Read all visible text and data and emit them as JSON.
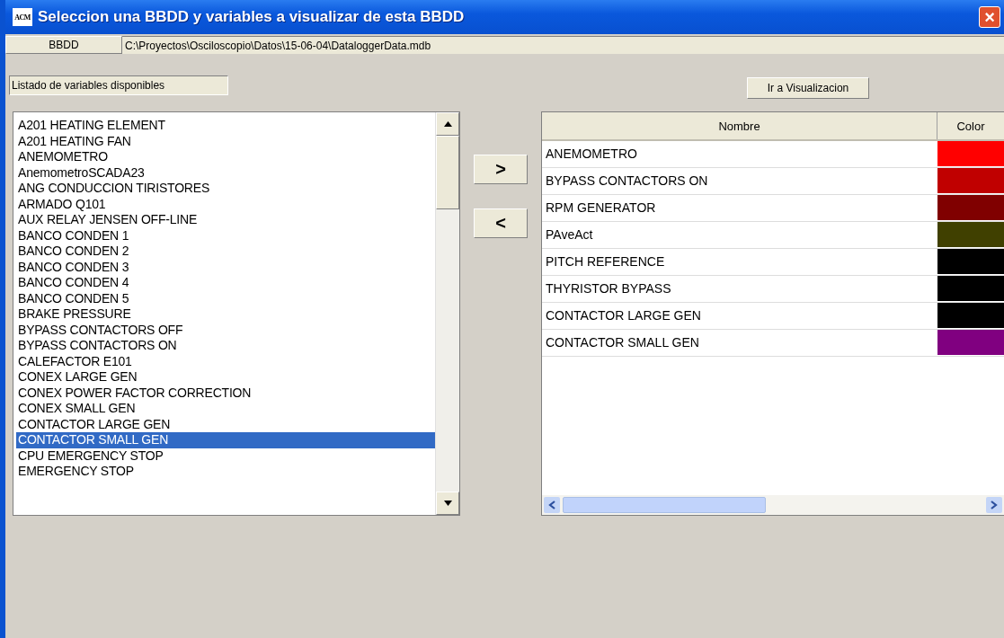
{
  "window": {
    "title": "Seleccion una BBDD y variables a visualizar de esta BBDD",
    "icon_letters": "ACM",
    "close": "×"
  },
  "database": {
    "button": "BBDD",
    "path": "C:\\Proyectos\\Osciloscopio\\Datos\\15-06-04\\DataloggerData.mdb"
  },
  "available_label": "Listado de variables disponibles",
  "go_button": "Ir a Visualizacion",
  "available": [
    {
      "label": "A201 HEATING ELEMENT",
      "selected": false
    },
    {
      "label": "A201 HEATING FAN",
      "selected": false
    },
    {
      "label": "ANEMOMETRO",
      "selected": false
    },
    {
      "label": "AnemometroSCADA23",
      "selected": false
    },
    {
      "label": "ANG CONDUCCION TIRISTORES",
      "selected": false
    },
    {
      "label": "ARMADO Q101",
      "selected": false
    },
    {
      "label": "AUX RELAY JENSEN OFF-LINE",
      "selected": false
    },
    {
      "label": "BANCO CONDEN 1",
      "selected": false
    },
    {
      "label": "BANCO CONDEN 2",
      "selected": false
    },
    {
      "label": "BANCO CONDEN 3",
      "selected": false
    },
    {
      "label": "BANCO CONDEN 4",
      "selected": false
    },
    {
      "label": "BANCO CONDEN 5",
      "selected": false
    },
    {
      "label": "BRAKE PRESSURE",
      "selected": false
    },
    {
      "label": "BYPASS CONTACTORS OFF",
      "selected": false
    },
    {
      "label": "BYPASS CONTACTORS ON",
      "selected": false
    },
    {
      "label": "CALEFACTOR E101",
      "selected": false
    },
    {
      "label": "CONEX LARGE GEN",
      "selected": false
    },
    {
      "label": "CONEX POWER FACTOR CORRECTION",
      "selected": false
    },
    {
      "label": "CONEX SMALL GEN",
      "selected": false
    },
    {
      "label": "CONTACTOR LARGE GEN",
      "selected": false
    },
    {
      "label": "CONTACTOR SMALL GEN",
      "selected": true
    },
    {
      "label": "CPU EMERGENCY STOP",
      "selected": false
    },
    {
      "label": "EMERGENCY STOP",
      "selected": false
    }
  ],
  "add_button": ">",
  "remove_button": "<",
  "table": {
    "columns": [
      "Nombre",
      "Color"
    ],
    "rows": [
      {
        "name": "ANEMOMETRO",
        "color": "#ff0000"
      },
      {
        "name": "BYPASS CONTACTORS ON",
        "color": "#c00000"
      },
      {
        "name": "RPM GENERATOR",
        "color": "#800000"
      },
      {
        "name": "PAveAct",
        "color": "#404000"
      },
      {
        "name": "PITCH REFERENCE",
        "color": "#000000"
      },
      {
        "name": "THYRISTOR BYPASS",
        "color": "#000000"
      },
      {
        "name": "CONTACTOR LARGE GEN",
        "color": "#000000"
      },
      {
        "name": "CONTACTOR SMALL GEN",
        "color": "#800080"
      }
    ]
  }
}
